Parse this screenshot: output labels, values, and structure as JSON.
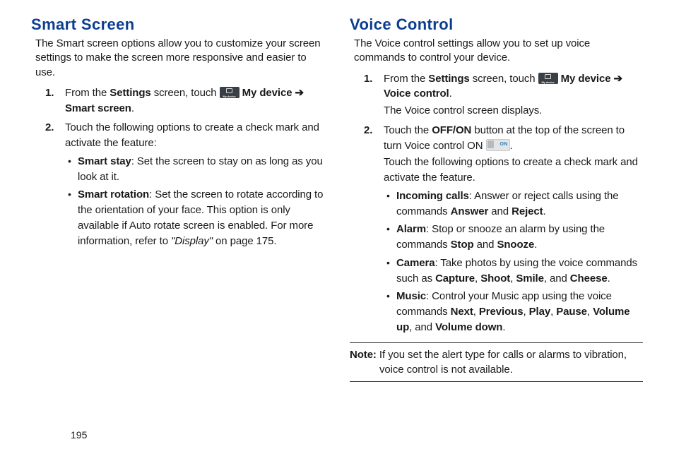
{
  "page_number": "195",
  "left": {
    "heading": "Smart Screen",
    "intro": "The Smart screen options allow you to customize your screen settings to make the screen more responsive and easier to use.",
    "step1": {
      "pre": "From the ",
      "bold1": "Settings",
      "mid": " screen, touch ",
      "bold2": "My device",
      "arrow": " ➔ ",
      "bold3": "Smart screen",
      "end": "."
    },
    "step2": {
      "text": "Touch the following options to create a check mark and activate the feature:",
      "bullets": [
        {
          "b": "Smart stay",
          "t": ": Set the screen to stay on as long as you look at it."
        },
        {
          "b": "Smart rotation",
          "t_pre": ": Set the screen to rotate according to the orientation of your face. This option is only available if Auto rotate screen is enabled. For more information, refer to ",
          "em": "\"Display\"",
          "t_post": "  on page 175."
        }
      ]
    }
  },
  "right": {
    "heading": "Voice Control",
    "intro": "The Voice control settings allow you to set up voice commands to control your device.",
    "step1": {
      "pre": "From the ",
      "bold1": "Settings",
      "mid": " screen, touch ",
      "bold2": "My device",
      "arrow": " ➔ ",
      "bold3": "Voice control",
      "end": ".",
      "after": "The Voice control screen displays."
    },
    "step2": {
      "p1_pre": "Touch the ",
      "p1_b": "OFF/ON",
      "p1_mid": " button at the top of the screen to turn Voice control ON ",
      "p1_end": ".",
      "p2": "Touch the following options to create a check mark and activate the feature.",
      "bullets": [
        {
          "b": "Incoming calls",
          "pre": ": Answer or reject calls using the commands ",
          "b1": "Answer",
          "mid": " and ",
          "b2": "Reject",
          "end": "."
        },
        {
          "b": "Alarm",
          "pre": ": Stop or snooze an alarm by using the commands ",
          "b1": "Stop",
          "mid": " and ",
          "b2": "Snooze",
          "end": "."
        },
        {
          "b": "Camera",
          "pre": ": Take photos by using the voice commands such as ",
          "b1": "Capture",
          "c1": ", ",
          "b2": "Shoot",
          "c2": ", ",
          "b3": "Smile",
          "c3": ", and ",
          "b4": "Cheese",
          "end": "."
        },
        {
          "b": "Music",
          "pre": ": Control your Music app using the voice commands ",
          "b1": "Next",
          "c1": ", ",
          "b2": "Previous",
          "c2": ", ",
          "b3": "Play",
          "c3": ", ",
          "b4": "Pause",
          "c4": ", ",
          "b5": "Volume up",
          "c5": ", and ",
          "b6": "Volume down",
          "end": "."
        }
      ]
    },
    "note_label": "Note:",
    "note_text": " If you set the alert type for calls or alarms to vibration, voice control is not available."
  }
}
